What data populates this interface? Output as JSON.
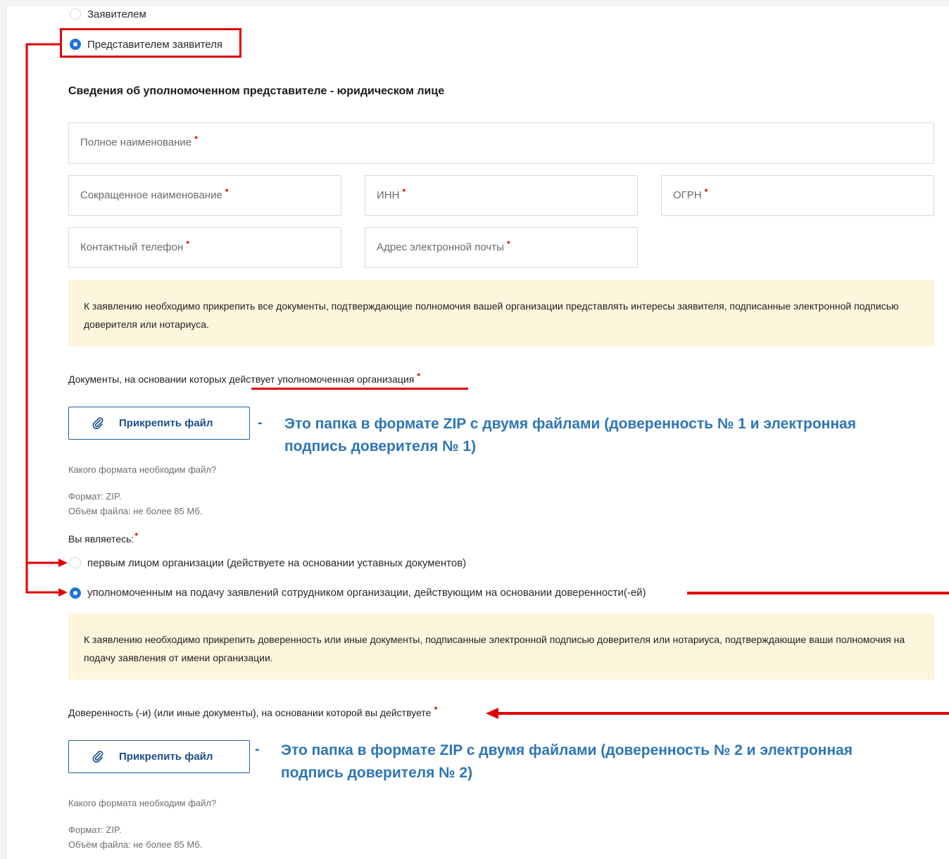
{
  "radios_top": {
    "applicant": "Заявителем",
    "representative": "Представителем заявителя"
  },
  "section": {
    "title": "Сведения об уполномоченном представителе - юридическом лице"
  },
  "fields": {
    "full_name": "Полное наименование",
    "short_name": "Сокращенное наименование",
    "inn": "ИНН",
    "ogrn": "ОГРН",
    "phone": "Контактный телефон",
    "email": "Адрес электронной почты",
    "required_mark": "•"
  },
  "note1": "К заявлению необходимо прикрепить все документы, подтверждающие полномочия вашей организации представлять интересы заявителя, подписанные электронной подписью доверителя или нотариуса.",
  "docs1": {
    "label_prefix": "Документы, на основании которых ",
    "label_underlined": "действует уполномоченная организация",
    "attach_label": "Прикрепить файл",
    "format_question": "Какого формата необходим файл?",
    "format": "Формат: ZIP.",
    "size": "Объём файла: не более 85 Мб.",
    "annotation_dash": "-",
    "annotation_line1": "Это папка в формате ZIP с двумя файлами (доверенность № 1 и электронная",
    "annotation_line2": "подпись доверителя № 1)"
  },
  "you_are": {
    "label": "Вы являетесь:",
    "option1": "первым лицом организации (действуете на основании уставных документов)",
    "option2": "уполномоченным на подачу заявлений сотрудником организации, действующим на основании доверенности(-ей)"
  },
  "note2": "К заявлению необходимо прикрепить доверенность или иные документы, подписанные электронной подписью доверителя или нотариуса, подтверждающие ваши полномочия на подачу заявления от имени организации.",
  "docs2": {
    "label": "Доверенность (-и) (или иные документы), на основании которой вы действуете",
    "attach_label": "Прикрепить файл",
    "format_question": "Какого формата необходим файл?",
    "format": "Формат: ZIP.",
    "size": "Объём файла: не более 85 Мб.",
    "annotation_dash": "-",
    "annotation_line1": "Это папка в формате ZIP с двумя файлами (доверенность № 2 и электронная",
    "annotation_line2": "подпись доверителя № 2)"
  },
  "colors": {
    "accent": "#1d73d6",
    "annotation": "#2e75b6",
    "highlight_red": "#e00000",
    "note_bg": "#fdf5dc"
  }
}
